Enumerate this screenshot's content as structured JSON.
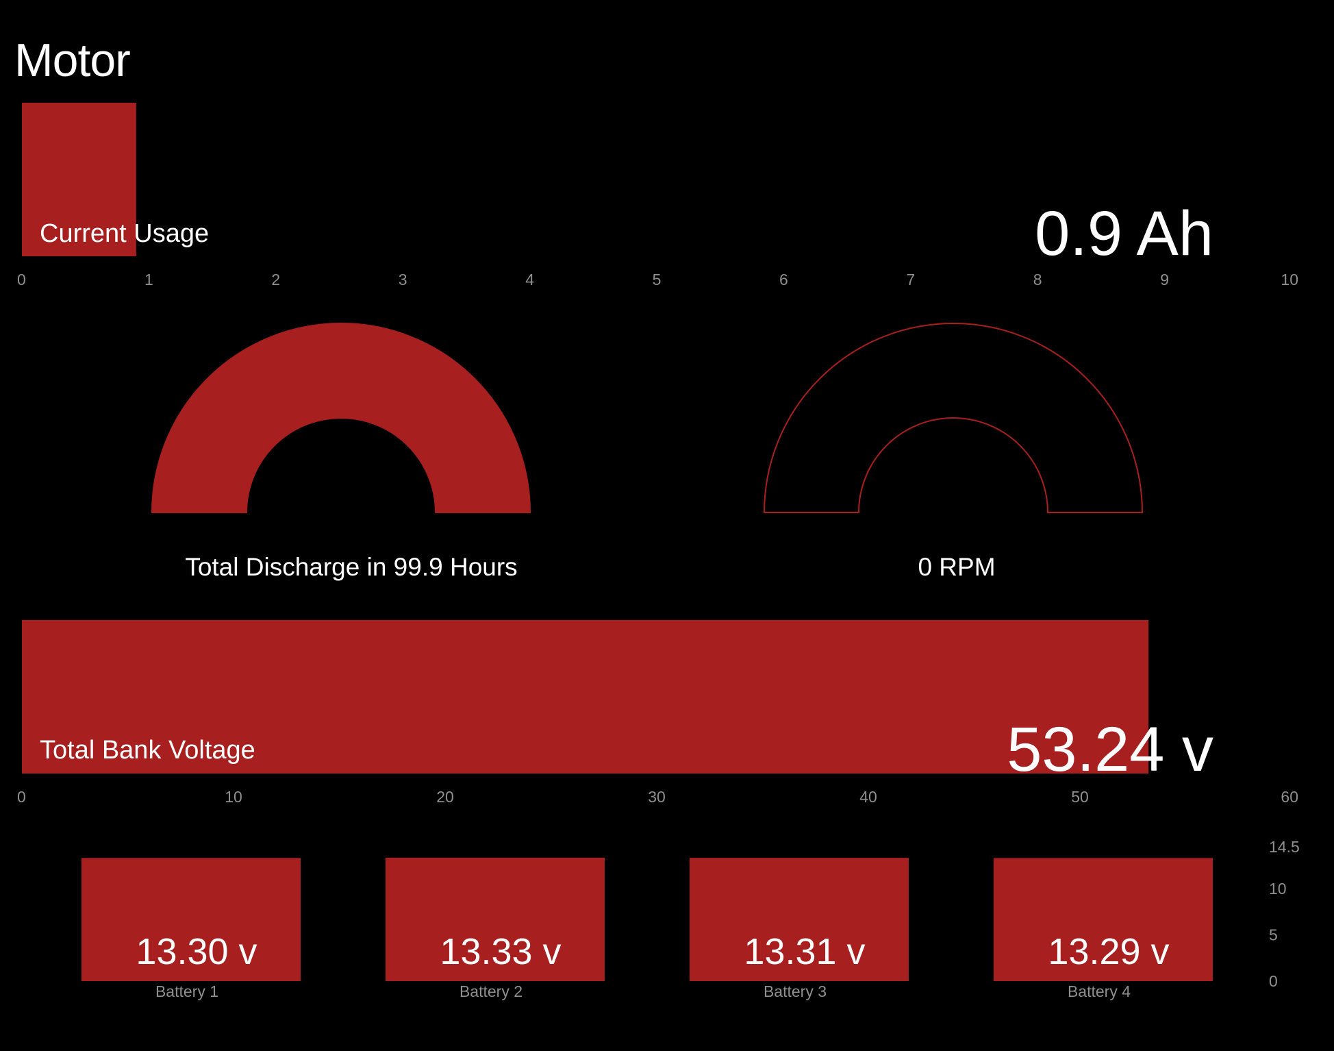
{
  "header": {
    "title": "Motor"
  },
  "colors": {
    "accent": "#a81f1f",
    "background": "#000000",
    "text": "#ffffff",
    "muted": "#8f8f8f"
  },
  "chart_data": [
    {
      "type": "bar",
      "id": "current-usage",
      "orientation": "horizontal",
      "label": "Current Usage",
      "value": 0.9,
      "display": "0.9 Ah",
      "xlim": [
        0,
        10
      ],
      "ticks": [
        "0",
        "1",
        "2",
        "3",
        "4",
        "5",
        "6",
        "7",
        "8",
        "9",
        "10"
      ]
    },
    {
      "type": "gauge",
      "id": "discharge-gauge",
      "label": "Total Discharge in 99.9 Hours",
      "fraction": 1.0
    },
    {
      "type": "gauge",
      "id": "rpm-gauge",
      "label": "0 RPM",
      "fraction": 0
    },
    {
      "type": "bar",
      "id": "bank-voltage",
      "orientation": "horizontal",
      "label": "Total Bank Voltage",
      "value": 53.24,
      "display": "53.24 v",
      "xlim": [
        0,
        60
      ],
      "ticks": [
        "0",
        "10",
        "20",
        "30",
        "40",
        "50",
        "60"
      ]
    },
    {
      "type": "bar",
      "id": "battery-voltages",
      "categories": [
        "Battery 1",
        "Battery 2",
        "Battery 3",
        "Battery 4"
      ],
      "values": [
        13.3,
        13.33,
        13.31,
        13.29
      ],
      "labels": [
        "13.30 v",
        "13.33 v",
        "13.31 v",
        "13.29 v"
      ],
      "ylim": [
        0,
        14.5
      ],
      "yticks": [
        "0",
        "5",
        "10",
        "14.5"
      ],
      "ytick_values": [
        0,
        5,
        10,
        14.5
      ]
    }
  ]
}
